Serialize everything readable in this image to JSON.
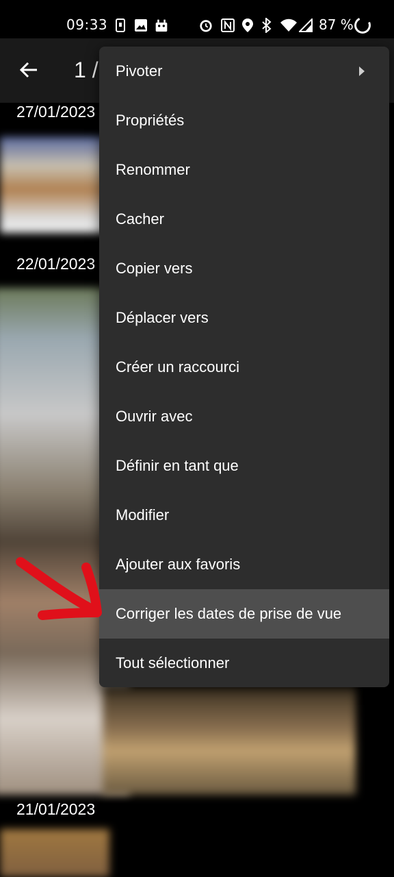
{
  "status_bar": {
    "time": "09:33",
    "battery": "87 %",
    "icons": [
      "sim-icon",
      "image-icon",
      "android-icon",
      "alarm-icon",
      "nfc-icon",
      "location-icon",
      "bluetooth-icon",
      "wifi-icon",
      "signal-icon",
      "battery-icon"
    ]
  },
  "app_bar": {
    "counter": "1 /"
  },
  "gallery": {
    "dates": [
      "27/01/2023",
      "22/01/2023",
      "21/01/2023"
    ]
  },
  "menu": {
    "items": [
      {
        "label": "Pivoter"
      },
      {
        "label": "Propriétés"
      },
      {
        "label": "Renommer"
      },
      {
        "label": "Cacher"
      },
      {
        "label": "Copier vers"
      },
      {
        "label": "Déplacer vers"
      },
      {
        "label": "Créer un raccourci"
      },
      {
        "label": "Ouvrir avec"
      },
      {
        "label": "Définir en tant que"
      },
      {
        "label": "Modifier"
      },
      {
        "label": "Ajouter aux favoris"
      },
      {
        "label": "Corriger les dates de prise de vue"
      },
      {
        "label": "Tout sélectionner"
      }
    ]
  },
  "colors": {
    "menu_bg": "#2d2d2d",
    "highlight": "#4e4e4e",
    "annotation_arrow": "#e0101a"
  }
}
